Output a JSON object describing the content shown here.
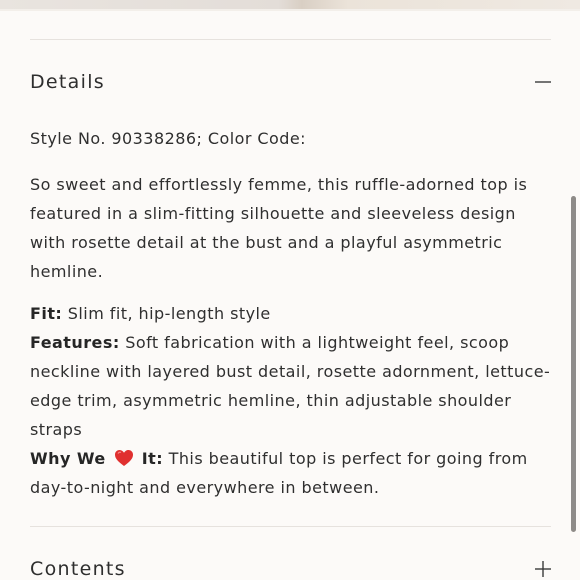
{
  "details": {
    "title": "Details",
    "style_number": "Style No. 90338286; Color Code:",
    "description": "So sweet and effortlessly femme, this ruffle-adorned top is featured in a slim-fitting silhouette and sleeveless design with rosette detail at the bust and a playful asymmetric hemline.",
    "fit_label": "Fit:",
    "fit_text": " Slim fit, hip-length style",
    "features_label": "Features:",
    "features_text": " Soft fabrication with a lightweight feel, scoop neckline with layered bust detail, rosette adornment, lettuce-edge trim, asymmetric hemline, thin adjustable shoulder straps",
    "why_label_before": "Why We ",
    "why_label_after": " It:",
    "why_text": " This beautiful top is perfect for going from day-to-night and everywhere in between."
  },
  "contents": {
    "title": "Contents"
  },
  "icons": {
    "collapse": "minus-icon",
    "expand": "plus-icon",
    "love": "heart-icon"
  },
  "colors": {
    "heart": "#e0302f",
    "background": "#fcfaf8"
  }
}
